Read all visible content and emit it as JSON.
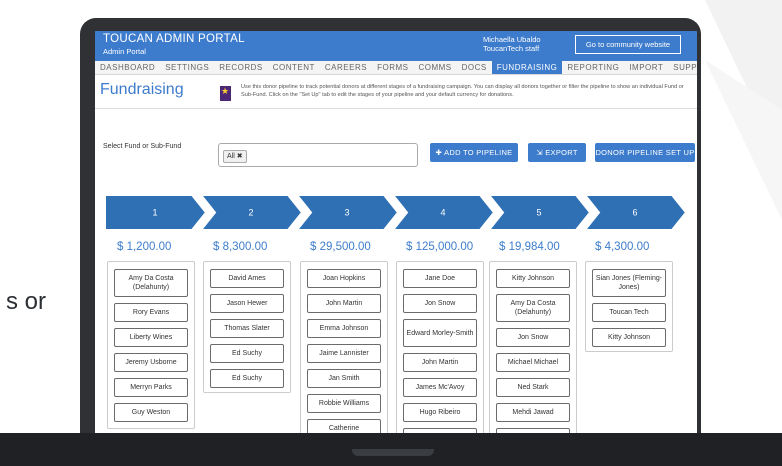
{
  "partial_word": "s or",
  "header": {
    "brand": "TOUCAN ADMIN PORTAL",
    "subtitle": "Admin Portal",
    "user_name": "Michaella Ubaldo",
    "user_role": "ToucanTech staff",
    "community_button": "Go to community website"
  },
  "nav": [
    "DASHBOARD",
    "SETTINGS",
    "RECORDS",
    "CONTENT",
    "CAREERS",
    "FORMS",
    "COMMS",
    "DOCS",
    "FUNDRAISING",
    "REPORTING",
    "IMPORT",
    "SUPPORT"
  ],
  "active_nav": "FUNDRAISING",
  "page": {
    "title": "Fundraising",
    "info": "Use this donor pipeline to track potential donors at different stages of a fundraising campaign. You can display all donors together or filter the pipeline to show an individual Fund or Sub-Fund. Click on the \"Set Up\" tab to edit the stages of your pipeline and your default currency for donations."
  },
  "fund": {
    "label": "Select Fund or Sub-Fund",
    "tag": "All ✖"
  },
  "buttons": {
    "add": "ADD TO PIPELINE",
    "export": "EXPORT",
    "setup": "DONOR PIPELINE SET UP"
  },
  "stages": [
    {
      "number": "1",
      "amount": "$ 1,200.00",
      "donors": [
        "Amy Da Costa (Delahunty)",
        "Rory Evans",
        "Liberty Wines",
        "Jeremy Usborne",
        "Merryn Parks",
        "Guy Weston"
      ]
    },
    {
      "number": "2",
      "amount": "$ 8,300.00",
      "donors": [
        "David Ames",
        "Jason Hewer",
        "Thomas Slater",
        "Ed Suchy",
        "Ed Suchy"
      ]
    },
    {
      "number": "3",
      "amount": "$ 29,500.00",
      "donors": [
        "Joan Hopkins",
        "John Martin",
        "Emma Johnson",
        "Jaime Lannister",
        "Jan Smith",
        "Robbie Williams",
        "Catherine"
      ]
    },
    {
      "number": "4",
      "amount": "$ 125,000.00",
      "donors": [
        "Jane Doe",
        "Jon Snow",
        "Edward Morley-Smith",
        "John Martin",
        "James Mc'Avoy",
        "Hugo Ribeiro",
        ""
      ]
    },
    {
      "number": "5",
      "amount": "$ 19,984.00",
      "donors": [
        "Kitty Johnson",
        "Amy Da Costa (Delahunty)",
        "Jon Snow",
        "Michael Michael",
        "Ned Stark",
        "Mehdi Jawad",
        ""
      ]
    },
    {
      "number": "6",
      "amount": "$ 4,300.00",
      "donors": [
        "Sian Jones (Fleming-Jones)",
        "Toucan Tech",
        "Kitty Johnson"
      ]
    }
  ],
  "colors": {
    "accent": "#3d7ccc",
    "stage_fill": "#2f6fb3",
    "laptop": "#2f3134"
  }
}
